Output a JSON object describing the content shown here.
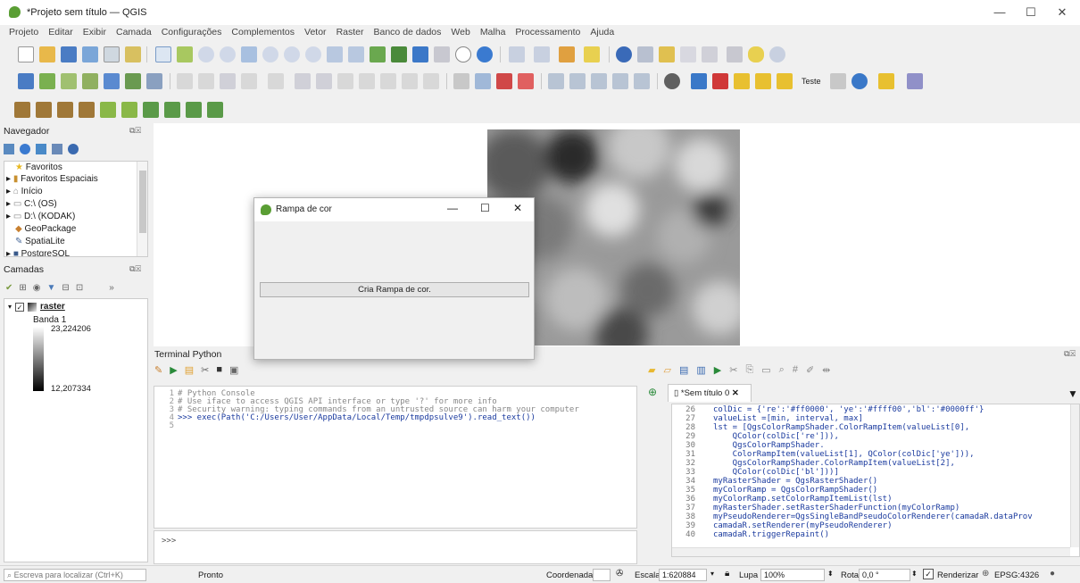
{
  "window": {
    "title": "*Projeto sem título — QGIS"
  },
  "menubar": [
    "Projeto",
    "Editar",
    "Exibir",
    "Camada",
    "Configurações",
    "Complementos",
    "Vetor",
    "Raster",
    "Banco de dados",
    "Web",
    "Malha",
    "Processamento",
    "Ajuda"
  ],
  "toolbar3": {
    "teste_label": "Teste"
  },
  "navigator": {
    "title": "Navegador",
    "items": [
      "Favoritos",
      "Favoritos Espaciais",
      "Início",
      "C:\\ (OS)",
      "D:\\ (KODAK)",
      "GeoPackage",
      "SpatiaLite",
      "PostgreSQL"
    ]
  },
  "layers": {
    "title": "Camadas",
    "layer_name": "raster",
    "band": "Banda 1",
    "max_value": "23,224206",
    "min_value": "12,207334"
  },
  "dialog": {
    "title": "Rampa de cor",
    "button": "Cria Rampa de cor."
  },
  "terminal": {
    "title": "Terminal Python",
    "console_lines": [
      {
        "n": "1",
        "text": "# Python Console"
      },
      {
        "n": "2",
        "text": "# Use iface to access QGIS API interface or type '?' for more info"
      },
      {
        "n": "3",
        "text": "# Security warning: typing commands from an untrusted source can harm your computer"
      },
      {
        "n": "4",
        "text": ">>> exec(Path('C:/Users/User/AppData/Local/Temp/tmpdpsulve9').read_text())"
      },
      {
        "n": "5",
        "text": ""
      }
    ],
    "prompt": ">>>",
    "editor_tab": "*Sem título 0",
    "editor_lines": [
      {
        "n": "26",
        "text": "colDic = {'re':'#ff0000', 'ye':'#ffff00','bl':'#0000ff'}"
      },
      {
        "n": "27",
        "text": "valueList =[min, interval, max]"
      },
      {
        "n": "28",
        "text": "lst = [QgsColorRampShader.ColorRampItem(valueList[0],"
      },
      {
        "n": "29",
        "text": "    QColor(colDic['re'])),"
      },
      {
        "n": "30",
        "text": "    QgsColorRampShader."
      },
      {
        "n": "31",
        "text": "    ColorRampItem(valueList[1], QColor(colDic['ye'])),"
      },
      {
        "n": "32",
        "text": "    QgsColorRampShader.ColorRampItem(valueList[2],"
      },
      {
        "n": "33",
        "text": "    QColor(colDic['bl']))]"
      },
      {
        "n": "34",
        "text": "myRasterShader = QgsRasterShader()"
      },
      {
        "n": "35",
        "text": "myColorRamp = QgsColorRampShader()"
      },
      {
        "n": "36",
        "text": "myColorRamp.setColorRampItemList(lst)"
      },
      {
        "n": "37",
        "text": "myRasterShader.setRasterShaderFunction(myColorRamp)"
      },
      {
        "n": "38",
        "text": "myPseudoRenderer=QgsSingleBandPseudoColorRenderer(camadaR.dataProv"
      },
      {
        "n": "39",
        "text": "camadaR.setRenderer(myPseudoRenderer)"
      },
      {
        "n": "40",
        "text": "camadaR.triggerRepaint()"
      }
    ]
  },
  "statusbar": {
    "search_placeholder": "Escreva para localizar (Ctrl+K)",
    "status": "Pronto",
    "coord_label": "Coordenada",
    "scale_label": "Escala",
    "scale_value": "1:620884",
    "zoom_label": "Lupa",
    "zoom_value": "100%",
    "rotation_label": "Rotação",
    "rotation_value": "0,0 °",
    "render_label": "Renderizar",
    "crs": "EPSG:4326"
  }
}
